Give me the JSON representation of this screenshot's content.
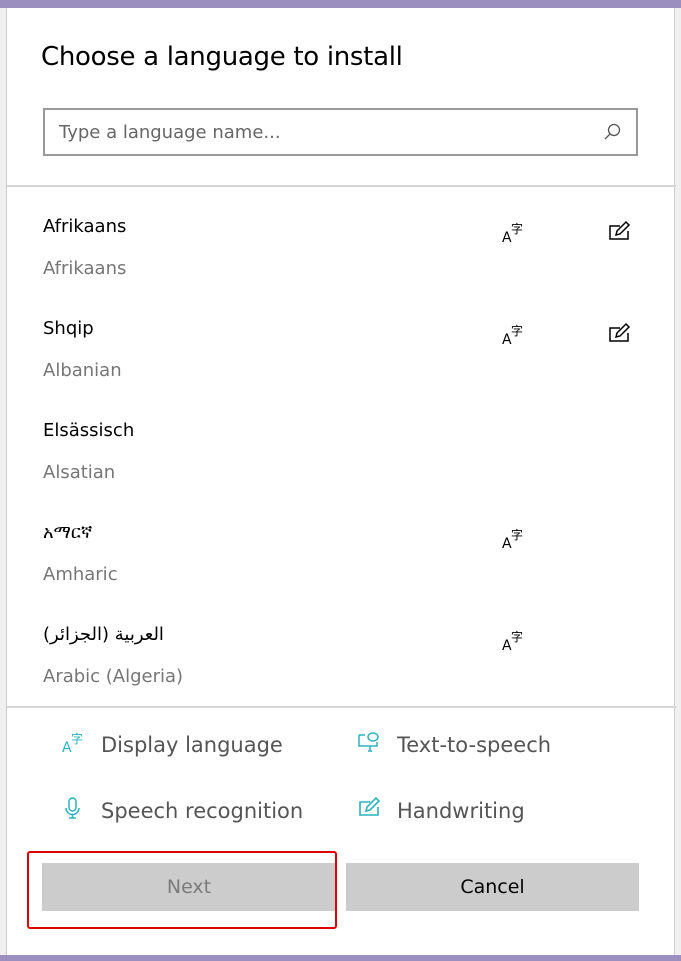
{
  "dialog": {
    "title": "Choose a language to install",
    "search_placeholder": "Type a language name...",
    "languages": [
      {
        "name": "Afrikaans",
        "english": "Afrikaans",
        "display_language": true,
        "handwriting": true
      },
      {
        "name": "Shqip",
        "english": "Albanian",
        "display_language": true,
        "handwriting": true
      },
      {
        "name": "Elsässisch",
        "english": "Alsatian",
        "display_language": false,
        "handwriting": false
      },
      {
        "name": "አማርኛ",
        "english": "Amharic",
        "display_language": true,
        "handwriting": false
      },
      {
        "name": "العربية (الجزائر)",
        "english": "Arabic (Algeria)",
        "display_language": true,
        "handwriting": false
      }
    ],
    "legend": {
      "display_language": "Display language",
      "text_to_speech": "Text-to-speech",
      "speech_recognition": "Speech recognition",
      "handwriting": "Handwriting"
    },
    "next_label": "Next",
    "cancel_label": "Cancel",
    "next_enabled": false
  },
  "colors": {
    "accent": "#2bb3c0",
    "highlight": "#e00000",
    "titlebar": "#9b8fc0"
  }
}
